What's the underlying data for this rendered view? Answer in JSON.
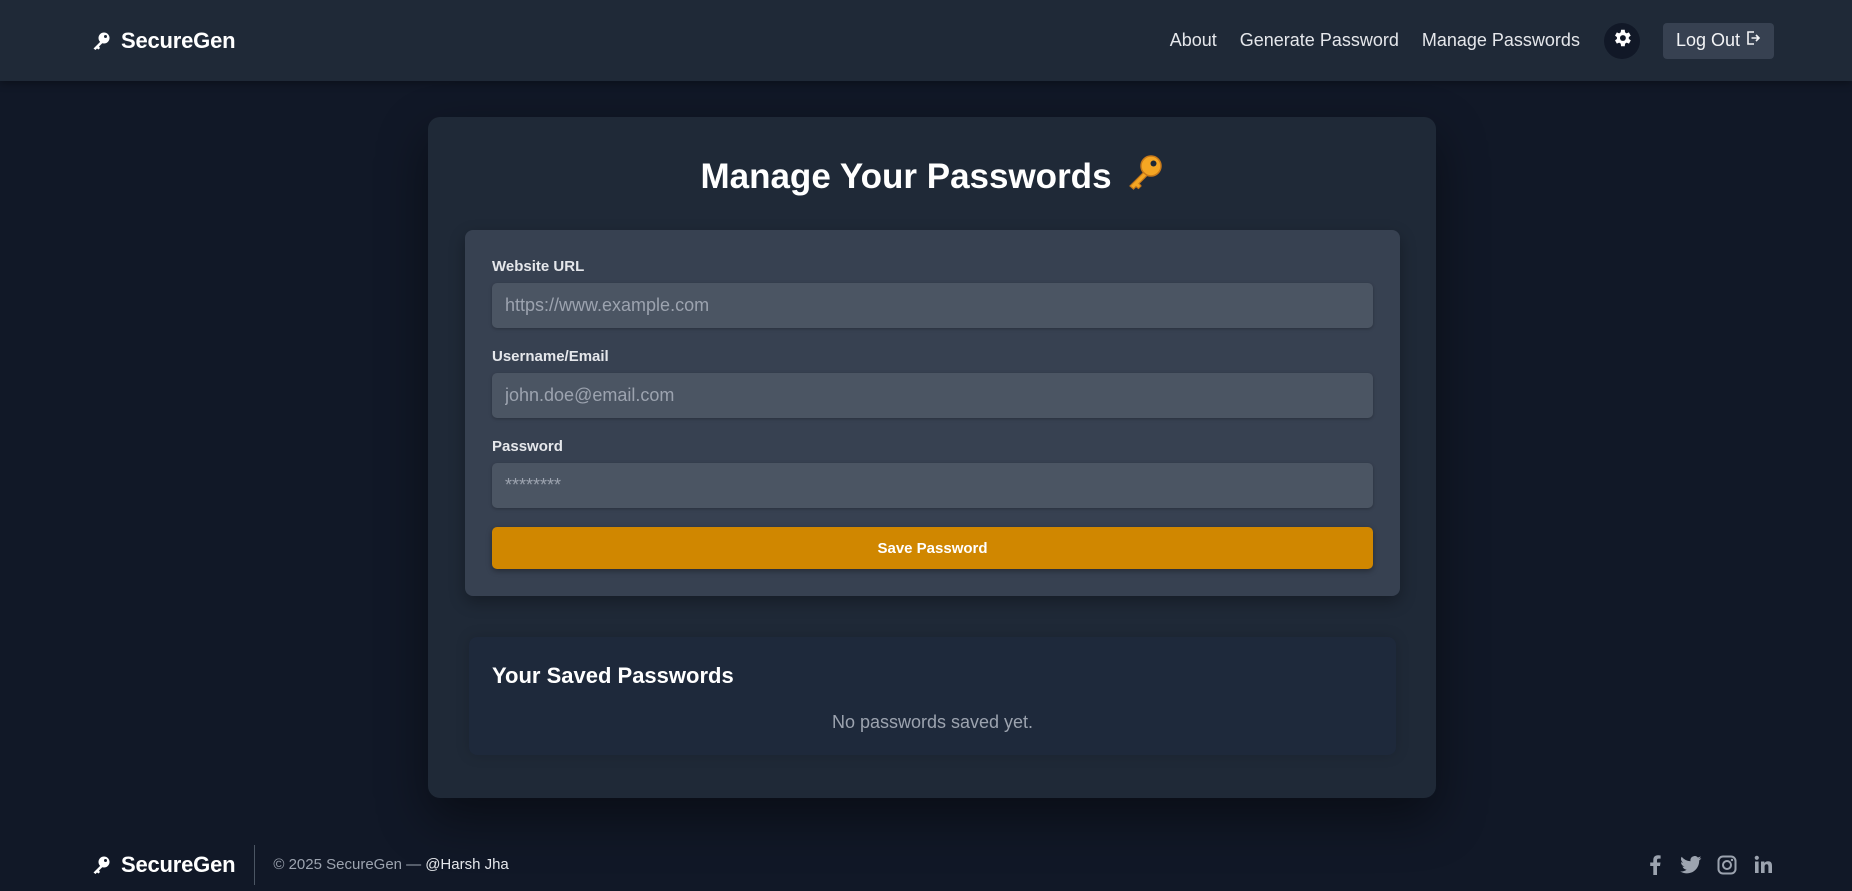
{
  "navbar": {
    "brand": "SecureGen",
    "brand_icon": "key-icon",
    "links": [
      "About",
      "Generate Password",
      "Manage Passwords"
    ],
    "theme_toggle_icon": "gear-icon",
    "logout_label": "Log Out",
    "logout_icon": "logout-icon"
  },
  "main": {
    "title": "Manage Your Passwords",
    "title_emoji": "🔑",
    "form": {
      "url_label": "Website URL",
      "url_placeholder": "https://www.example.com",
      "user_label": "Username/Email",
      "user_placeholder": "john.doe@email.com",
      "password_label": "Password",
      "password_placeholder": "********",
      "save_label": "Save Password"
    },
    "saved": {
      "title": "Your Saved Passwords",
      "empty_text": "No passwords saved yet."
    }
  },
  "footer": {
    "brand": "SecureGen",
    "copyright": "© 2025 SecureGen —",
    "author": "@Harsh Jha",
    "socials": [
      "facebook-icon",
      "twitter-icon",
      "instagram-icon",
      "linkedin-icon"
    ]
  },
  "colors": {
    "background": "#111827",
    "navbar": "#1f2937",
    "card": "#1f2937",
    "form_panel": "#374151",
    "input": "#4b5563",
    "accent": "#d08700"
  }
}
